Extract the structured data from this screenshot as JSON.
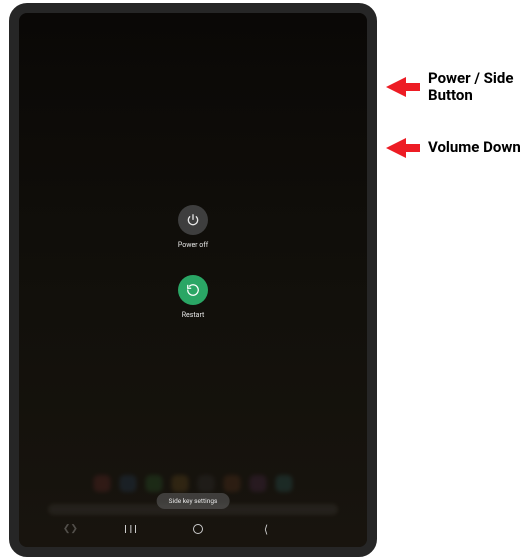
{
  "powerMenu": {
    "powerOff": {
      "label": "Power off"
    },
    "restart": {
      "label": "Restart"
    }
  },
  "sideKey": {
    "label": "Side key settings"
  },
  "annotations": {
    "power": "Power / Side\nButton",
    "volume": "Volume Down"
  },
  "dockColors": [
    "#7a2f2f",
    "#284a6e",
    "#2f6e34",
    "#7a5a22",
    "#3a3a3a",
    "#6e3e22",
    "#5a2f5a",
    "#2f6e6e"
  ],
  "colors": {
    "restartGreen": "#2aa665",
    "arrowRed": "#ed1c24"
  }
}
